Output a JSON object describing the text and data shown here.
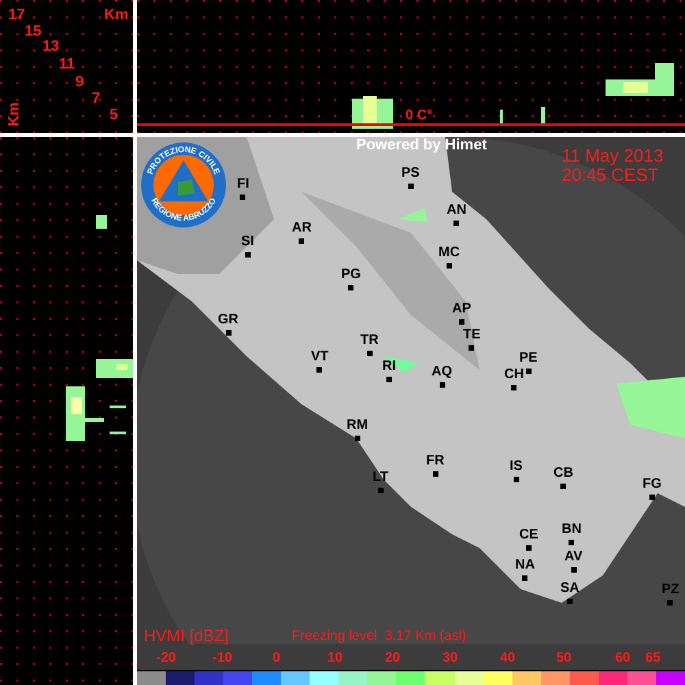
{
  "height_axis": {
    "labels": [
      "17",
      "15",
      "13",
      "11",
      "9",
      "7",
      "5"
    ],
    "unit_top": "Km",
    "unit_side": "Km"
  },
  "cross_section": {
    "freezing_label": "0 C°"
  },
  "logo": {
    "top_text": "PROTEZIONE CIVILE",
    "bottom_text": "REGIONE ABRUZZO"
  },
  "map": {
    "credit": "Powered by Himet",
    "date": "11 May 2013",
    "time": "20:45 CEST",
    "cities": [
      "FI",
      "SI",
      "AR",
      "PG",
      "GR",
      "PS",
      "AN",
      "MC",
      "AP",
      "TE",
      "PE",
      "CH",
      "AQ",
      "TR",
      "VT",
      "RI",
      "RM",
      "FR",
      "LT",
      "IS",
      "CB",
      "FG",
      "CE",
      "BN",
      "AV",
      "NA",
      "SA",
      "PZ"
    ]
  },
  "legend": {
    "title": "HVMI [dBZ]",
    "freezing_level": "Freezing level  3.17 Km (asl)",
    "ticks": [
      "-20",
      "-10",
      "0",
      "10",
      "20",
      "30",
      "40",
      "50",
      "60",
      "65"
    ],
    "swatches": [
      {
        "color": "#8c8c8c"
      },
      {
        "color": "#1c1c6e"
      },
      {
        "color": "#3232c8"
      },
      {
        "color": "#4646f0"
      },
      {
        "color": "#1e8cff"
      },
      {
        "color": "#64c8ff"
      },
      {
        "color": "#96ffff"
      },
      {
        "color": "#96f5c8"
      },
      {
        "color": "#96f596"
      },
      {
        "color": "#6eff6e"
      },
      {
        "color": "#c8ff64"
      },
      {
        "color": "#e6ff96"
      },
      {
        "color": "#ffff64"
      },
      {
        "color": "#ffc864"
      },
      {
        "color": "#ff9664"
      },
      {
        "color": "#ff5a4b"
      },
      {
        "color": "#ff2878"
      },
      {
        "color": "#ff5096"
      },
      {
        "color": "#c800ff"
      }
    ]
  }
}
